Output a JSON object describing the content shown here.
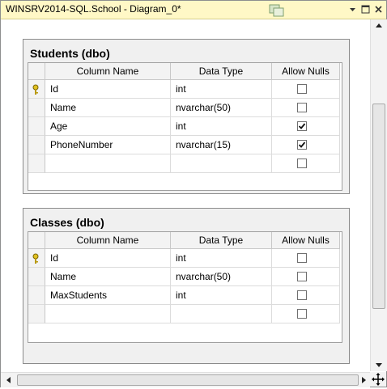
{
  "window": {
    "title": "WINSRV2014-SQL.School - Diagram_0*"
  },
  "headers": {
    "column_name": "Column Name",
    "data_type": "Data Type",
    "allow_nulls": "Allow Nulls"
  },
  "tables": [
    {
      "title": "Students (dbo)",
      "rows": [
        {
          "name": "Id",
          "type": "int",
          "nulls": false,
          "pk": true
        },
        {
          "name": "Name",
          "type": "nvarchar(50)",
          "nulls": false,
          "pk": false
        },
        {
          "name": "Age",
          "type": "int",
          "nulls": true,
          "pk": false
        },
        {
          "name": "PhoneNumber",
          "type": "nvarchar(15)",
          "nulls": true,
          "pk": false
        },
        {
          "name": "",
          "type": "",
          "nulls": false,
          "pk": false
        }
      ]
    },
    {
      "title": "Classes (dbo)",
      "rows": [
        {
          "name": "Id",
          "type": "int",
          "nulls": false,
          "pk": true
        },
        {
          "name": "Name",
          "type": "nvarchar(50)",
          "nulls": false,
          "pk": false
        },
        {
          "name": "MaxStudents",
          "type": "int",
          "nulls": false,
          "pk": false
        },
        {
          "name": "",
          "type": "",
          "nulls": false,
          "pk": false
        }
      ]
    }
  ],
  "icons": {
    "primary_key": "key-icon",
    "window_menu": "dropdown-arrow-icon",
    "maximize": "maximize-icon",
    "close": "close-icon",
    "move": "move-cross-icon"
  },
  "colors": {
    "titlebar": "#fff8c6",
    "table_frame": "#f0f0f0",
    "key": "#e0c020"
  }
}
